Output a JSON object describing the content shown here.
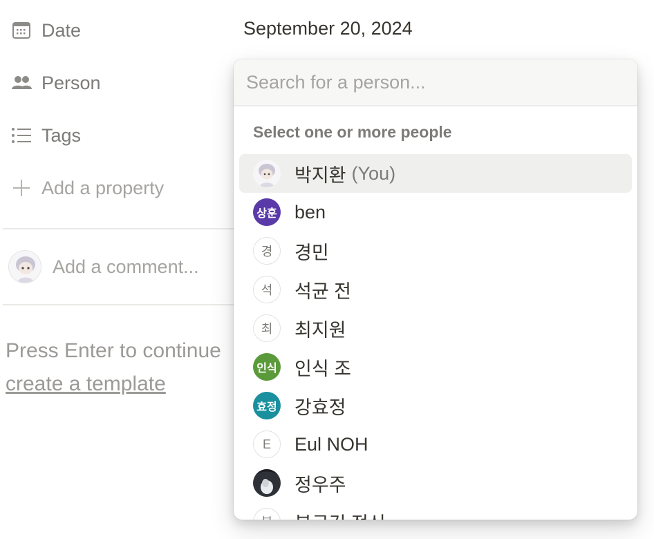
{
  "properties": {
    "date": {
      "label": "Date",
      "value": "September 20, 2024",
      "icon": "calendar-icon"
    },
    "person": {
      "label": "Person",
      "icon": "people-icon"
    },
    "tags": {
      "label": "Tags",
      "icon": "list-icon"
    },
    "add": {
      "label": "Add a property",
      "icon": "plus-icon"
    }
  },
  "comment": {
    "placeholder": "Add a comment..."
  },
  "hint": {
    "text": "Press Enter to continue",
    "link": "create a template"
  },
  "dropdown": {
    "search_placeholder": "Search for a person...",
    "section_header": "Select one or more people",
    "people": [
      {
        "name": "박지환",
        "suffix": "(You)",
        "avatar_type": "photo-boy",
        "selected": true
      },
      {
        "name": "ben",
        "avatar_type": "color",
        "initials": "상훈",
        "color": "#5a3aa8"
      },
      {
        "name": "경민",
        "avatar_type": "letter",
        "initials": "경"
      },
      {
        "name": "석균 전",
        "avatar_type": "letter",
        "initials": "석"
      },
      {
        "name": "최지원",
        "avatar_type": "letter",
        "initials": "최"
      },
      {
        "name": "인식 조",
        "avatar_type": "color",
        "initials": "인식",
        "color": "#5a9a3a"
      },
      {
        "name": "강효정",
        "avatar_type": "color",
        "initials": "효정",
        "color": "#1a8f9e"
      },
      {
        "name": "Eul NOH",
        "avatar_type": "letter",
        "initials": "E"
      },
      {
        "name": "정우주",
        "avatar_type": "photo-dark"
      },
      {
        "name": "봉근긱 정신",
        "avatar_type": "letter",
        "initials": "봉"
      }
    ]
  }
}
